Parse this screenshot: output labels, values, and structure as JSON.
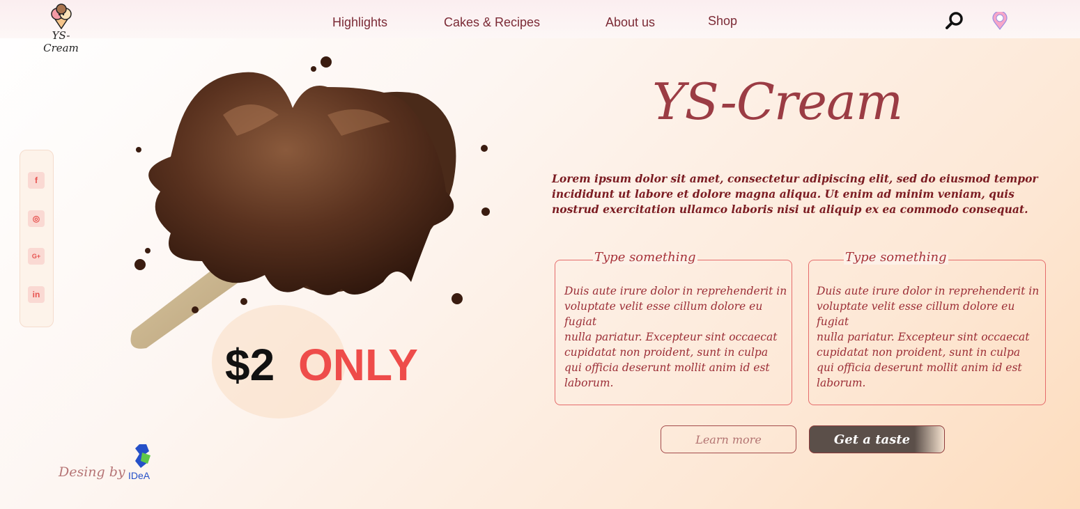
{
  "brand": {
    "name": "YS-Cream",
    "logo_text": "YS-Cream"
  },
  "nav": [
    {
      "label": "Highlights"
    },
    {
      "label": "Cakes & Recipes"
    },
    {
      "label": "About us"
    },
    {
      "label": "Shop"
    }
  ],
  "header_icons": {
    "search": "search-icon",
    "location": "location-pin-icon"
  },
  "social": [
    {
      "name": "facebook-icon",
      "glyph": "f"
    },
    {
      "name": "instagram-icon",
      "glyph": "◎"
    },
    {
      "name": "google-plus-icon",
      "glyph": "G+"
    },
    {
      "name": "linkedin-icon",
      "glyph": "in"
    }
  ],
  "hero": {
    "image": "chocolate-ice-cream-bar",
    "price": "$2",
    "price_suffix": "ONLY"
  },
  "intro": "Lorem ipsum dolor sit amet, consectetur adipiscing elit, sed do eiusmod tempor incididunt ut labore et dolore magna aliqua. Ut enim ad minim veniam, quis nostrud exercitation ullamco laboris nisi ut aliquip ex ea commodo consequat.",
  "cards": [
    {
      "label": "Type something",
      "text": "Duis aute irure dolor in reprehenderit in voluptate velit esse cillum dolore eu fugiat\nnulla pariatur. Excepteur sint occaecat cupidatat non proident, sunt in culpa qui officia deserunt mollit anim id est laborum."
    },
    {
      "label": "Type something",
      "text": "Duis aute irure dolor in reprehenderit in voluptate velit esse cillum dolore eu fugiat\nnulla pariatur. Excepteur sint occaecat cupidatat non proident, sunt in culpa qui officia deserunt mollit anim id est laborum."
    }
  ],
  "buttons": {
    "learn_more": "Learn more",
    "get_taste": "Get a taste"
  },
  "credit": {
    "text": "Desing by",
    "logo_text": "IDeA"
  },
  "colors": {
    "accent": "#9b3c44",
    "price_highlight": "#ee4c4a",
    "button_dark": "#5b4f49",
    "border": "#e56b6b"
  }
}
